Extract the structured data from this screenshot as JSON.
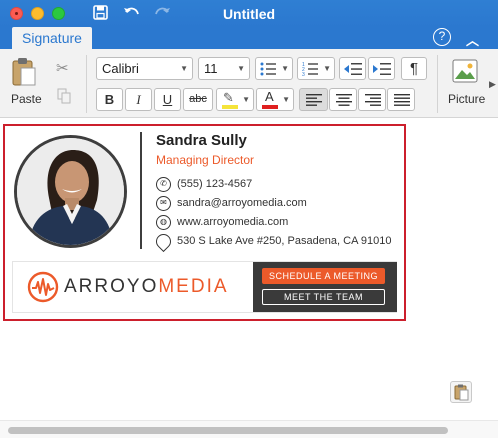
{
  "window": {
    "title": "Untitled"
  },
  "toolbar": {
    "save_icon": "save-icon",
    "undo_icon": "undo-icon",
    "redo_icon": "redo-icon"
  },
  "tabs": [
    {
      "label": "Signature",
      "active": true
    }
  ],
  "ribbon": {
    "paste_label": "Paste",
    "font_name": "Calibri",
    "font_size": "11",
    "bold": "B",
    "italic": "I",
    "underline": "U",
    "strikethrough": "abc",
    "highlight_glyph": "✎",
    "font_color_glyph": "A",
    "paragraph_mark": "¶",
    "picture_label": "Picture",
    "alignment_selected": "left"
  },
  "signature": {
    "name": "Sandra Sully",
    "title": "Managing Director",
    "contacts": [
      {
        "icon": "phone-icon",
        "text": "(555) 123-4567"
      },
      {
        "icon": "email-icon",
        "text": "sandra@arroyomedia.com"
      },
      {
        "icon": "globe-icon",
        "text": "www.arroyomedia.com"
      },
      {
        "icon": "location-icon",
        "text": "530 S Lake Ave #250, Pasadena, CA 91010"
      }
    ],
    "logo_part1": "ARROYO",
    "logo_part2": "MEDIA",
    "cta_primary": "SCHEDULE A MEETING",
    "cta_secondary": "MEET THE TEAM"
  },
  "colors": {
    "titlebar": "#2b78cf",
    "accent_orange": "#ec5a2a",
    "highlight_border": "#cc1f2c",
    "dark_panel": "#3a3a3a"
  }
}
